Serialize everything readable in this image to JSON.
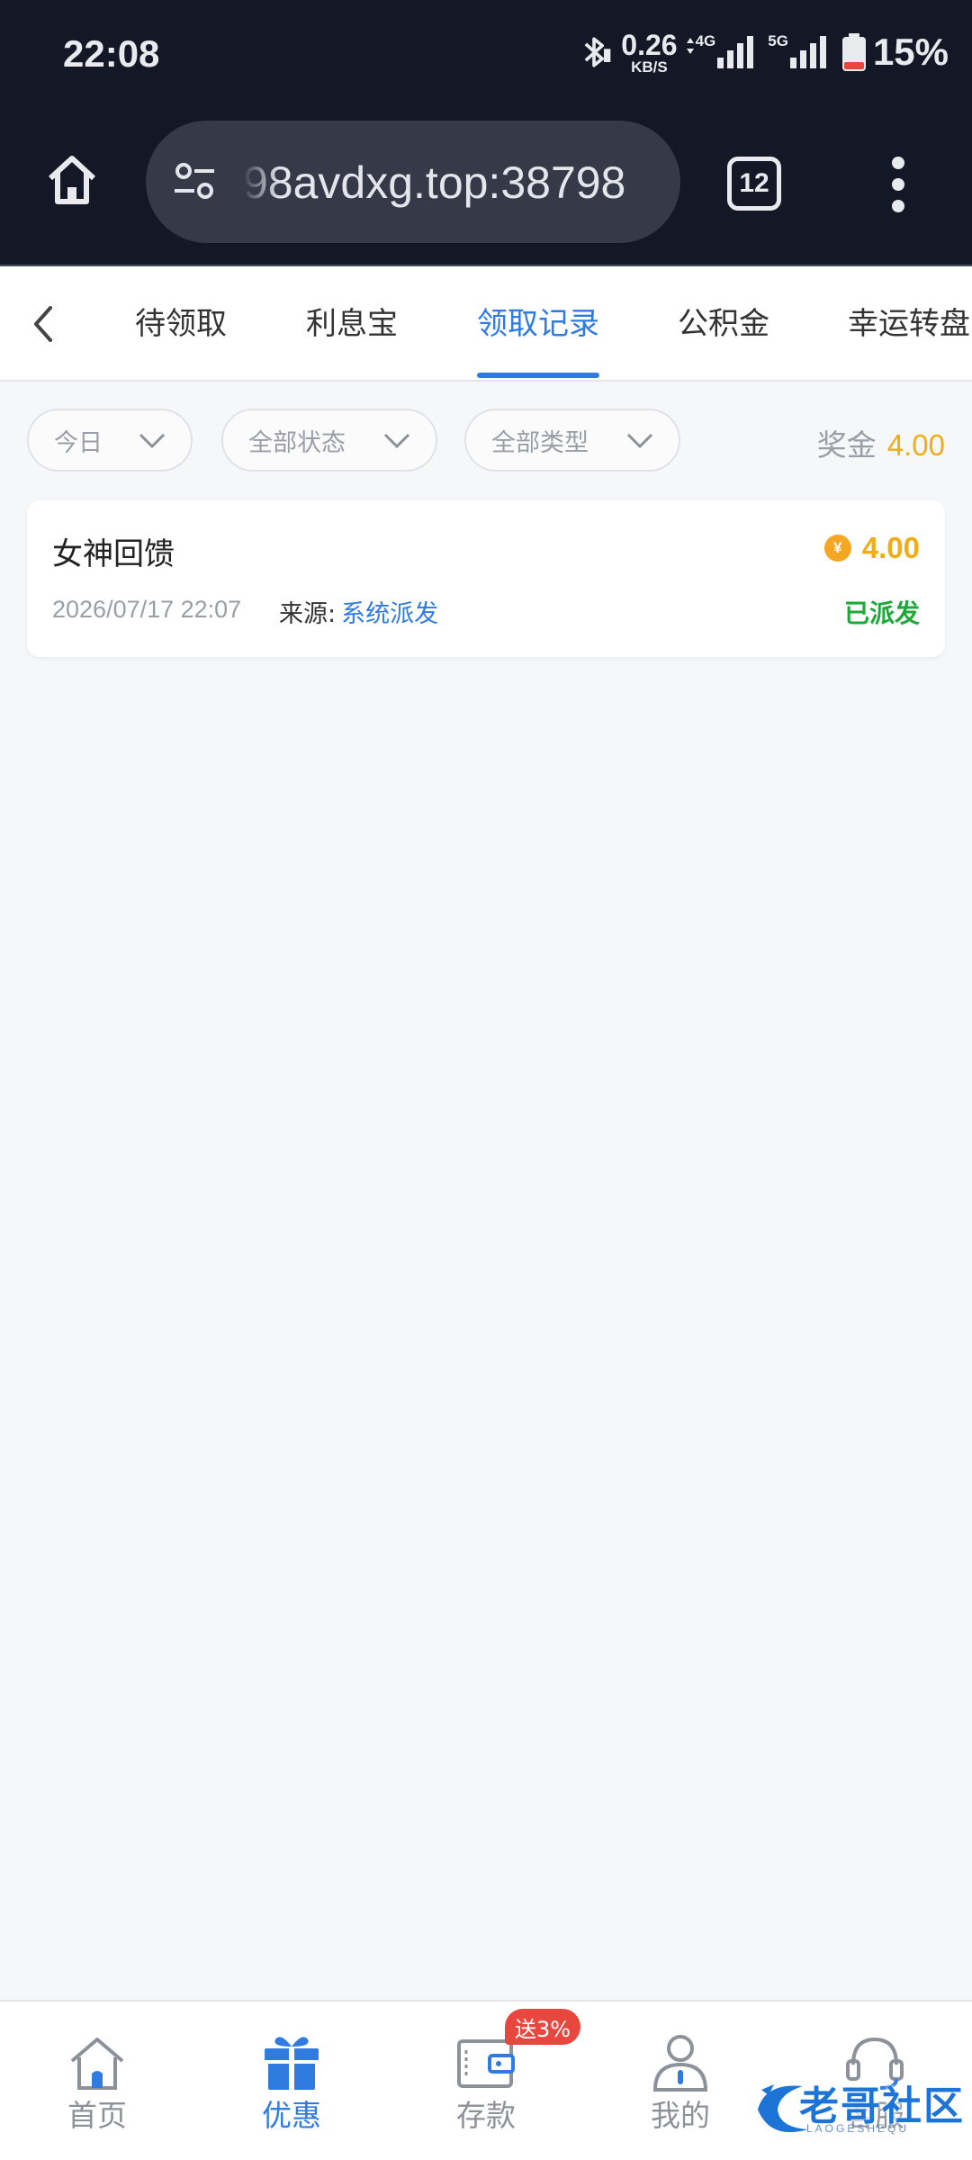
{
  "status_bar": {
    "time": "22:08",
    "net_speed_value": "0.26",
    "net_speed_unit": "KB/S",
    "signal1_label": "4G",
    "signal2_label": "5G",
    "battery_percent": "15%"
  },
  "browser": {
    "url": "98avdxg.top:38798",
    "tab_count": "12"
  },
  "category_tabs": [
    {
      "label": "待领取",
      "active": false
    },
    {
      "label": "利息宝",
      "active": false
    },
    {
      "label": "领取记录",
      "active": true
    },
    {
      "label": "公积金",
      "active": false
    },
    {
      "label": "幸运转盘",
      "active": false
    }
  ],
  "filters": {
    "date": "今日",
    "status": "全部状态",
    "type": "全部类型"
  },
  "bonus": {
    "label": "奖金",
    "value": "4.00"
  },
  "records": [
    {
      "title": "女神回馈",
      "amount": "4.00",
      "currency_symbol": "¥",
      "datetime": "2026/07/17 22:07",
      "source_label": "来源:",
      "source_value": "系统派发",
      "status": "已派发"
    }
  ],
  "bottom_nav": [
    {
      "label": "首页",
      "icon": "home-icon",
      "active": false
    },
    {
      "label": "优惠",
      "icon": "gift-icon",
      "active": true
    },
    {
      "label": "存款",
      "icon": "wallet-icon",
      "active": false
    },
    {
      "label": "我的",
      "icon": "user-icon",
      "active": false
    },
    {
      "label": "客服",
      "icon": "headset-icon",
      "active": false
    }
  ],
  "promo_badge": "送3%",
  "watermark": {
    "text": "老哥社区",
    "sub": "LAOGESHEQU"
  },
  "colors": {
    "accent": "#2f7be0",
    "gold": "#f0ad17",
    "success": "#1fa83a",
    "badge": "#e8473e",
    "topbar": "#141826"
  }
}
